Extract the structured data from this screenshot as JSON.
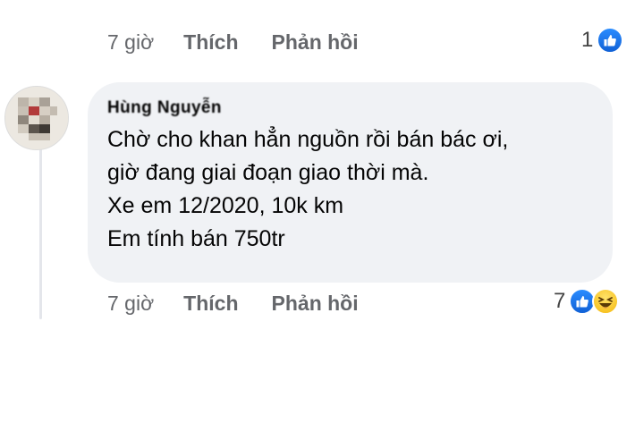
{
  "comment_above": {
    "time": "7 giờ",
    "like_label": "Thích",
    "reply_label": "Phản hồi",
    "reaction_count": "1",
    "reactions": [
      "like-icon"
    ]
  },
  "comment": {
    "author": "Hùng Nguyễn",
    "lines": [
      "Chờ cho khan hẳn nguồn rồi bán bác ơi,",
      "giờ đang giai đoạn giao thời mà.",
      "Xe em 12/2020,  10k km",
      "Em tính bán 750tr"
    ],
    "time": "7 giờ",
    "like_label": "Thích",
    "reply_label": "Phản hồi",
    "reaction_count": "7",
    "reactions": [
      "like-icon",
      "haha-icon"
    ]
  },
  "colors": {
    "bubble": "#f0f2f5",
    "meta_text": "#65676b",
    "like_blue": "#1877f2",
    "haha_yellow": "#f7c531"
  }
}
